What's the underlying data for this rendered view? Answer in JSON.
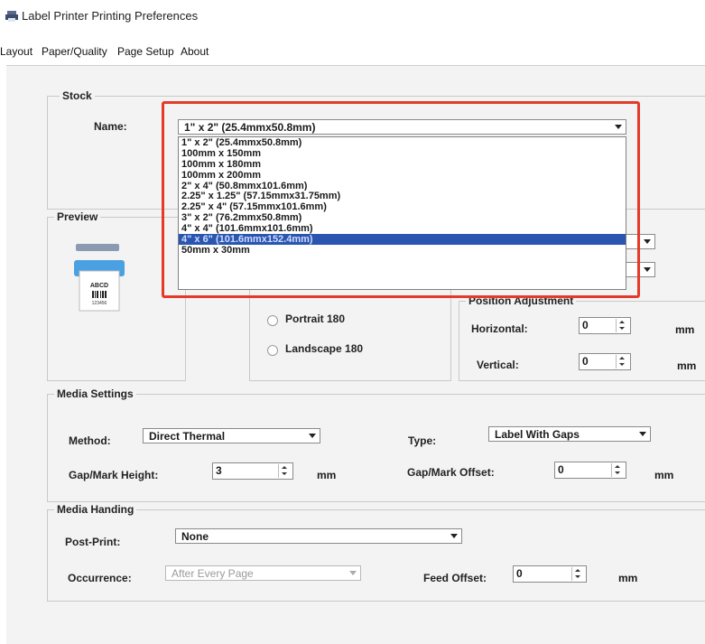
{
  "window": {
    "title": "Label Printer Printing Preferences",
    "icon": "printer-icon"
  },
  "tabs": [
    "Layout",
    "Paper/Quality",
    "Page Setup",
    "About"
  ],
  "stock": {
    "group_label": "Stock",
    "name_label": "Name:",
    "selected": "1\" x 2\" (25.4mmx50.8mm)",
    "options": [
      "1\" x 2\" (25.4mmx50.8mm)",
      "100mm x 150mm",
      "100mm x 180mm",
      "100mm x 200mm",
      "2\" x 4\" (50.8mmx101.6mm)",
      "2.25\" x 1.25\" (57.15mmx31.75mm)",
      "2.25\" x 4\" (57.15mmx101.6mm)",
      "3\" x 2\" (76.2mmx50.8mm)",
      "4\" x 4\" (101.6mmx101.6mm)",
      "4\" x 6\" (101.6mmx152.4mm)",
      "50mm x 30mm"
    ],
    "highlighted_option": "4\" x 6\" (101.6mmx152.4mm)"
  },
  "preview": {
    "group_label": "Preview",
    "label_text": "ABCD",
    "label_subtext": "123456",
    "icon": "label-printer-icon"
  },
  "orientation": {
    "portrait_180": "Portrait 180",
    "landscape_180": "Landscape 180"
  },
  "position_adjustment": {
    "group_label": "Position Adjustment",
    "horizontal_label": "Horizontal:",
    "horizontal_value": "0",
    "vertical_label": "Vertical:",
    "vertical_value": "0",
    "unit": "mm"
  },
  "media_settings": {
    "group_label": "Media Settings",
    "method_label": "Method:",
    "method_value": "Direct Thermal",
    "type_label": "Type:",
    "type_value": "Label With Gaps",
    "gap_height_label": "Gap/Mark Height:",
    "gap_height_value": "3",
    "gap_offset_label": "Gap/Mark Offset:",
    "gap_offset_value": "0",
    "unit": "mm"
  },
  "media_handling": {
    "group_label": "Media Handing",
    "post_print_label": "Post-Print:",
    "post_print_value": "None",
    "occurrence_label": "Occurrence:",
    "occurrence_value": "After Every Page",
    "feed_offset_label": "Feed Offset:",
    "feed_offset_value": "0",
    "unit": "mm"
  },
  "colors": {
    "highlight_border": "#e53a2a",
    "selection": "#2a56b0",
    "panel": "#f3f3f3"
  }
}
